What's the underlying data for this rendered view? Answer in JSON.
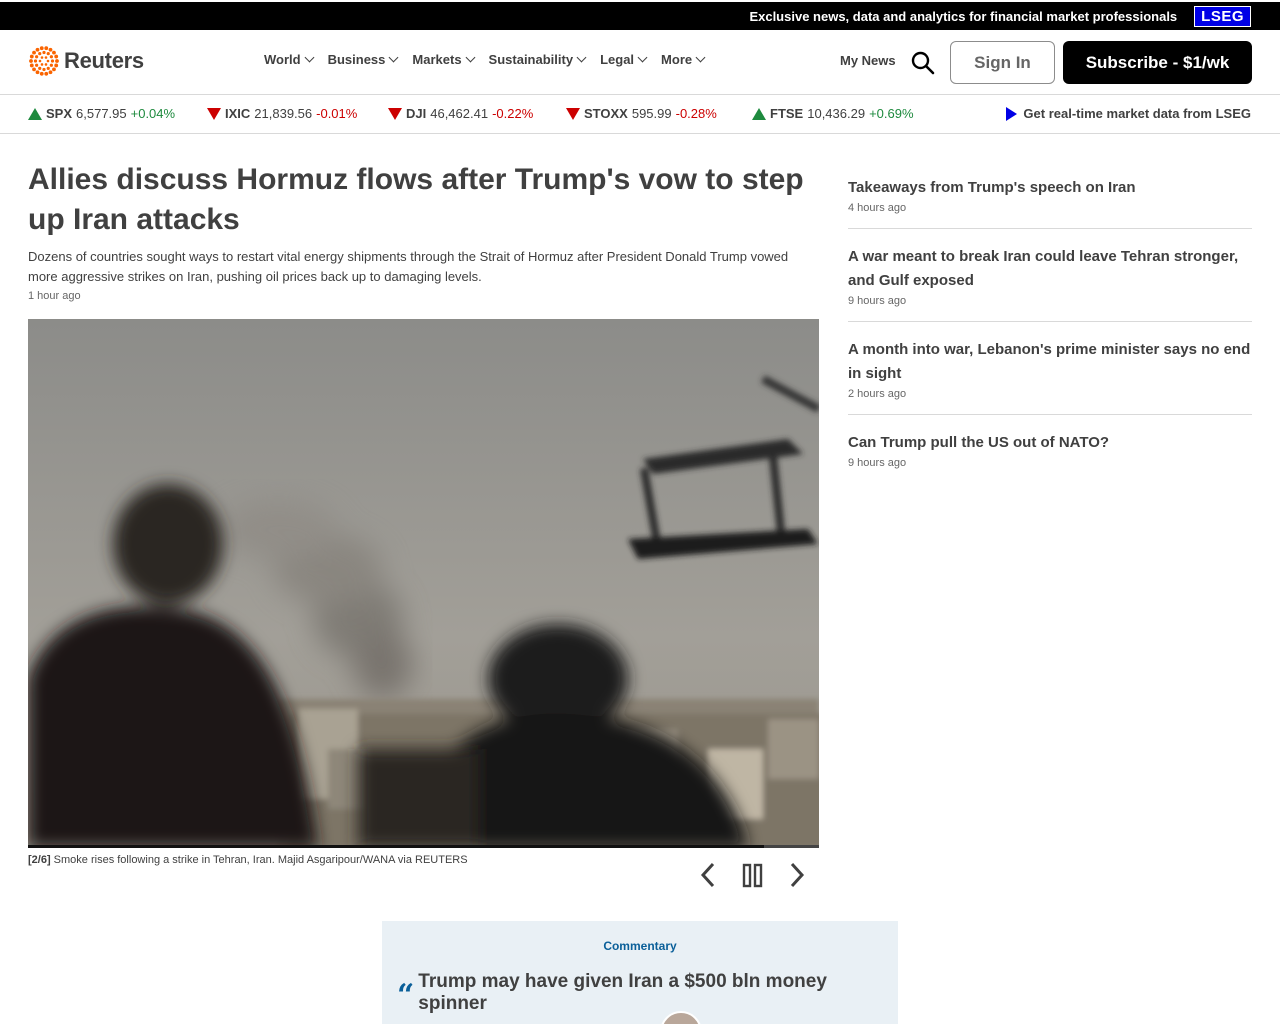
{
  "topbar": {
    "text": "Exclusive news, data and analytics for financial market professionals",
    "badge": "LSEG"
  },
  "header": {
    "logo_text": "Reuters",
    "nav": [
      "World",
      "Business",
      "Markets",
      "Sustainability",
      "Legal",
      "More"
    ],
    "my_news": "My News",
    "sign_in": "Sign In",
    "subscribe": "Subscribe - $1/wk"
  },
  "ticker": {
    "items": [
      {
        "symbol": "SPX",
        "value": "6,577.95",
        "change": "+0.04%",
        "direction": "up"
      },
      {
        "symbol": "IXIC",
        "value": "21,839.56",
        "change": "-0.01%",
        "direction": "down"
      },
      {
        "symbol": "DJI",
        "value": "46,462.41",
        "change": "-0.22%",
        "direction": "down"
      },
      {
        "symbol": "STOXX",
        "value": "595.99",
        "change": "-0.28%",
        "direction": "down"
      },
      {
        "symbol": "FTSE",
        "value": "10,436.29",
        "change": "+0.69%",
        "direction": "up"
      }
    ],
    "lseg_link": "Get real-time market data from LSEG"
  },
  "story": {
    "headline": "Allies discuss Hormuz flows after Trump's vow to step up Iran attacks",
    "dek": "Dozens of countries sought ways to restart vital energy shipments through the Strait of Hormuz after President Donald Trump vowed more aggressive strikes on Iran, pushing oil prices back up to damaging levels.",
    "timestamp": "1 hour ago",
    "caption_index": "[2/6]",
    "caption": " Smoke rises following a strike in Tehran, Iran. Majid Asgaripour/WANA via REUTERS",
    "slideshow_progress": 0.93
  },
  "sidebar": [
    {
      "title": "Takeaways from Trump's speech on Iran",
      "time": "4 hours ago"
    },
    {
      "title": "A war meant to break Iran could leave Tehran stronger, and Gulf exposed",
      "time": "9 hours ago"
    },
    {
      "title": "A month into war, Lebanon's prime minister says no end in sight",
      "time": "2 hours ago"
    },
    {
      "title": "Can Trump pull the US out of NATO?",
      "time": "9 hours ago"
    }
  ],
  "commentary": {
    "label": "Commentary",
    "title": "Trump may have given Iran a $500 bln money spinner"
  },
  "icons": {
    "logo": "reuters-logo-icon",
    "search": "search-icon",
    "prev": "chevron-left-icon",
    "pause": "pause-icon",
    "next": "chevron-right-icon",
    "quote": "quote-icon"
  },
  "colors": {
    "accent_orange": "#fa6400",
    "lseg_blue": "#0000e6",
    "up": "#1e8a3e",
    "down": "#c00000",
    "commentary_blue": "#0a5f99"
  }
}
